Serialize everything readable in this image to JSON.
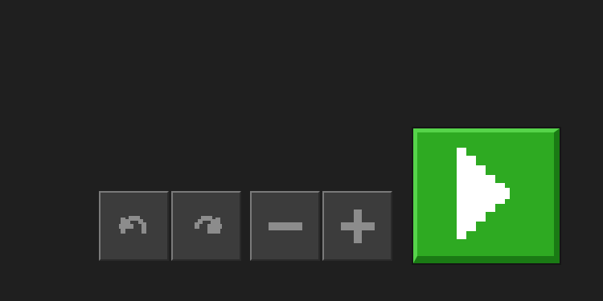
{
  "toolbar": {
    "buttons": [
      {
        "id": "undo",
        "icon": "undo-arrow-icon"
      },
      {
        "id": "redo",
        "icon": "redo-arrow-icon"
      },
      {
        "id": "zoom-out",
        "icon": "minus-icon"
      },
      {
        "id": "zoom-in",
        "icon": "plus-icon"
      }
    ],
    "icon_color": "#8c8c8c",
    "button_color": "#3c3c3c"
  },
  "play": {
    "icon": "play-triangle-icon",
    "color": "#2eaa22",
    "icon_color": "#ffffff"
  }
}
